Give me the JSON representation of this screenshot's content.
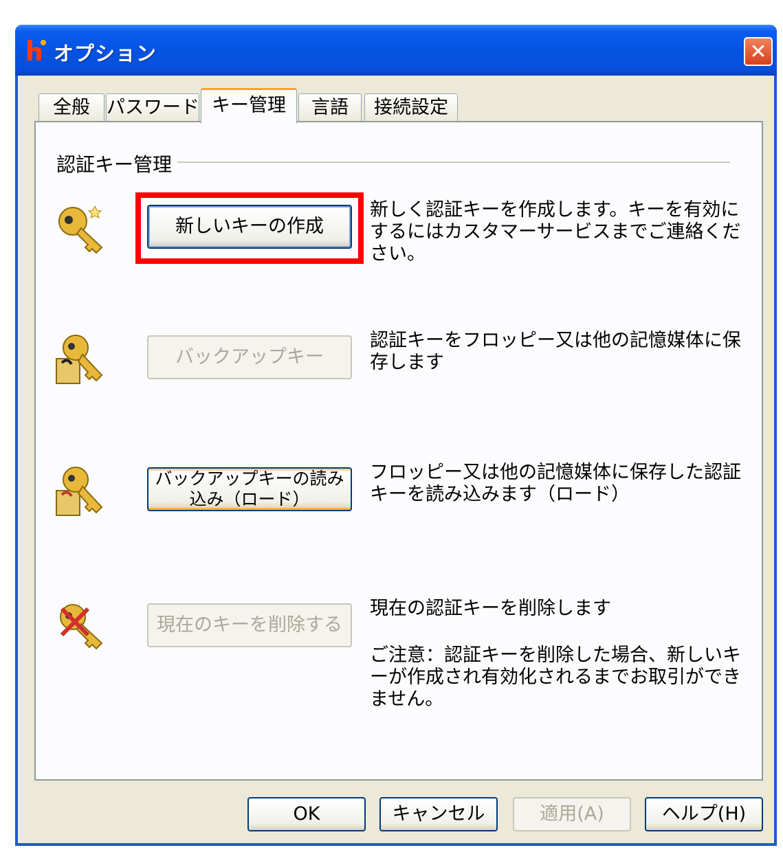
{
  "window": {
    "title": "オプション",
    "close_symbol": "✕",
    "icon": "app-icon"
  },
  "tabs": [
    {
      "label": "全般",
      "active": false
    },
    {
      "label": "パスワード",
      "active": false
    },
    {
      "label": "キー管理",
      "active": true
    },
    {
      "label": "言語",
      "active": false
    },
    {
      "label": "接続設定",
      "active": false
    }
  ],
  "group": {
    "label": "認証キー管理"
  },
  "actions": [
    {
      "icon": "key-new-icon",
      "button_label": "新しいキーの作成",
      "enabled": true,
      "description": "新しく認証キーを作成します。キーを有効にするにはカスタマーサービスまでご連絡ください。"
    },
    {
      "icon": "key-backup-icon",
      "button_label": "バックアップキー",
      "enabled": false,
      "description": "認証キーをフロッピー又は他の記憶媒体に保存します"
    },
    {
      "icon": "key-load-icon",
      "button_label": "バックアップキーの読み込み（ロード）",
      "enabled": true,
      "description": "フロッピー又は他の記憶媒体に保存した認証キーを読み込みます（ロード）"
    },
    {
      "icon": "key-delete-icon",
      "button_label": "現在のキーを削除する",
      "enabled": false,
      "description": "現在の認証キーを削除します",
      "note": "ご注意：認証キーを削除した場合、新しいキーが作成され有効化されるまでお取引ができません。"
    }
  ],
  "footer": {
    "ok": "OK",
    "cancel": "キャンセル",
    "apply": "適用(A)",
    "help": "ヘルプ(H)"
  },
  "colors": {
    "titlebar": "#0553e2",
    "highlight": "#ff0000",
    "key": "#e8b83a"
  }
}
